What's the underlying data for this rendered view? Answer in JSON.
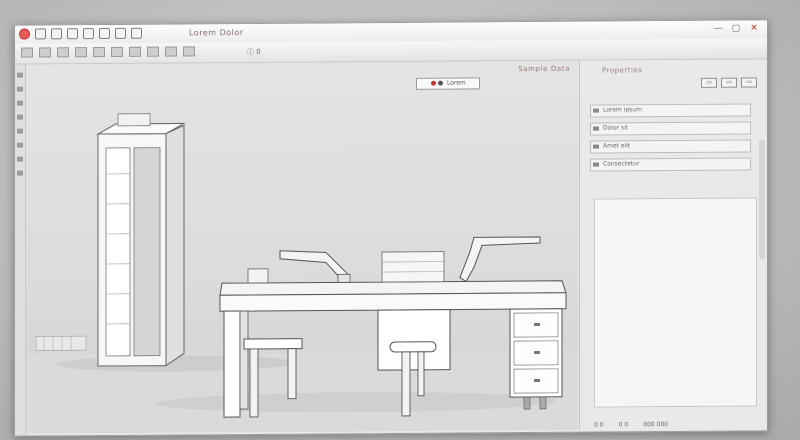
{
  "window": {
    "title": "Lorem Dolor",
    "controls": [
      "—",
      "▢",
      "✕"
    ]
  },
  "toolbar": {
    "secondary_label": "ⓘ 0"
  },
  "viewport": {
    "header": "Sample  Data",
    "select_label": "Lorem"
  },
  "panel": {
    "heading": "Properties",
    "controls": [
      "▭",
      "▭",
      "▭"
    ],
    "rows": [
      {
        "label": "Lorem ipsum"
      },
      {
        "label": "Dolor sit"
      },
      {
        "label": "Amet elit"
      },
      {
        "label": "Consectetur"
      }
    ],
    "footer": [
      "0 0",
      "0 0",
      "000 000"
    ]
  },
  "colors": {
    "accent_red": "#c53535",
    "window_bg": "#e8e8e8",
    "viewport_bg": "#dcdcdc"
  }
}
